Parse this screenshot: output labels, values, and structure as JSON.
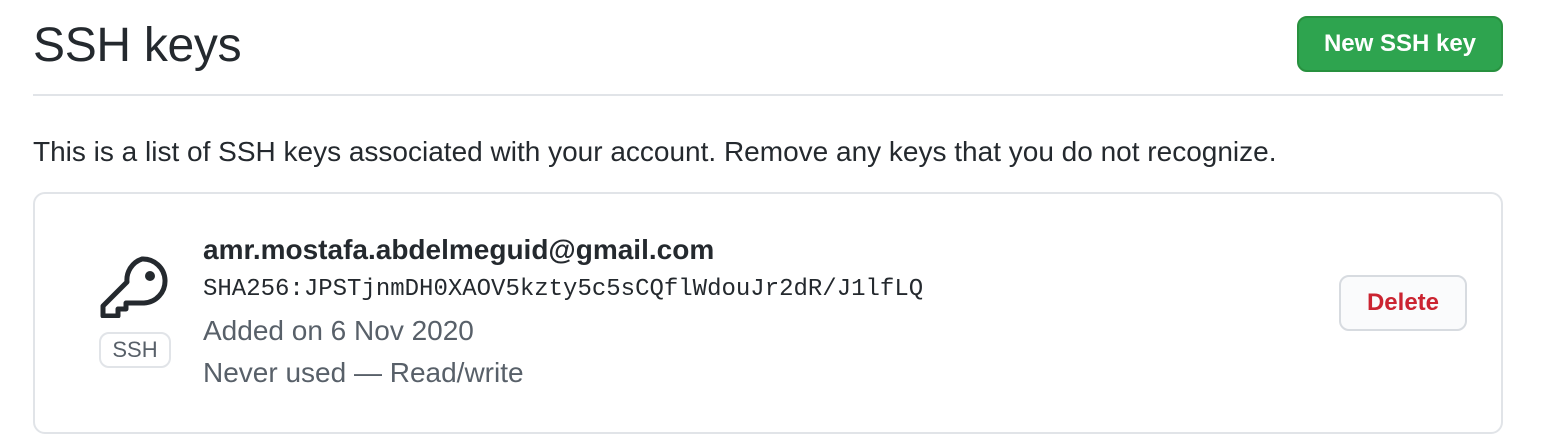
{
  "header": {
    "title": "SSH keys",
    "new_key_label": "New SSH key"
  },
  "intro": "This is a list of SSH keys associated with your account. Remove any keys that you do not recognize.",
  "keys": [
    {
      "icon": "key-icon",
      "type_badge": "SSH",
      "title": "amr.mostafa.abdelmeguid@gmail.com",
      "fingerprint": "SHA256:JPSTjnmDH0XAOV5kzty5c5sCQflWdouJr2dR/J1lfLQ",
      "added": "Added on 6 Nov 2020",
      "usage": "Never used — Read/write",
      "delete_label": "Delete"
    }
  ],
  "colors": {
    "primary_button": "#2ea44f",
    "danger_text": "#cb2431",
    "muted_text": "#586069",
    "border": "#e1e4e8"
  }
}
